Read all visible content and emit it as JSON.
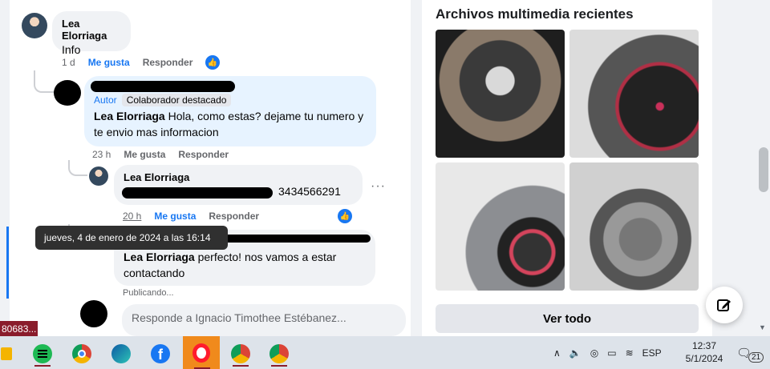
{
  "comments": [
    {
      "name": "Lea Elorriaga",
      "text": "Info",
      "time": "1 d",
      "like_label": "Me gusta",
      "reply_label": "Responder"
    },
    {
      "badge_author": "Autor",
      "badge_top": "Colaborador destacado",
      "mention": "Lea Elorriaga",
      "text": " Hola, como estas? dejame tu numero y te envio mas informacion",
      "time": "23 h",
      "like_label": "Me gusta",
      "reply_label": "Responder"
    },
    {
      "name": "Lea Elorriaga",
      "text_visible": "3434566291",
      "time": "20 h",
      "like_label": "Me gusta",
      "reply_label": "Responder"
    },
    {
      "mention": "Lea Elorriaga",
      "text": " perfecto! nos vamos a estar contactando",
      "status": "Publicando..."
    }
  ],
  "tooltip": "jueves, 4 de enero de 2024 a las 16:14",
  "more_menu": "···",
  "reply_placeholder": "Responde a Ignacio Timothee Estébanez...",
  "media": {
    "title": "Archivos multimedia recientes",
    "see_all": "Ver todo"
  },
  "tab_badge": "80683...",
  "taskbar": {
    "language": "ESP",
    "time": "12:37",
    "date": "5/1/2024",
    "notifications": "21",
    "icons": [
      "file-explorer-icon",
      "spotify-icon",
      "chrome-icon",
      "edge-icon",
      "facebook-icon",
      "opera-icon",
      "chrome-profile-icon",
      "chrome-profile-2-icon"
    ]
  },
  "colors": {
    "facebook_blue": "#1877f2",
    "bubble_gray": "#f0f2f5",
    "author_bubble": "#e7f3ff",
    "tooltip_bg": "#303030",
    "opera_active": "#f08a1c"
  }
}
